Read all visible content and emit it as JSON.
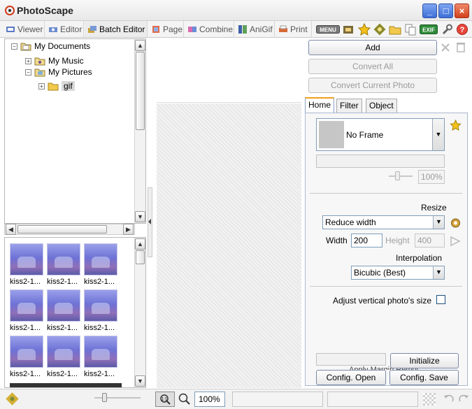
{
  "window": {
    "title": "PhotoScape",
    "colors": {
      "accent": "#3d6fd8",
      "close": "#d2401c",
      "folder": "#f2c94c"
    }
  },
  "tabs": [
    {
      "label": "Viewer",
      "icon": "viewer-icon"
    },
    {
      "label": "Editor",
      "icon": "editor-icon"
    },
    {
      "label": "Batch Editor",
      "icon": "batch-editor-icon"
    },
    {
      "label": "Page",
      "icon": "page-icon"
    },
    {
      "label": "Combine",
      "icon": "combine-icon"
    },
    {
      "label": "AniGif",
      "icon": "anigif-icon"
    },
    {
      "label": "Print",
      "icon": "print-icon"
    }
  ],
  "toolbar_icons": [
    "menu-icon",
    "film-icon",
    "star-icon",
    "gear-icon",
    "folder-icon",
    "copy-icon",
    "exif-icon",
    "wrench-icon",
    "help-icon"
  ],
  "toolbar": {
    "menu_label": "MENU",
    "exif_label": "EXIF"
  },
  "tree": {
    "root": "My Documents",
    "children": [
      "My Music",
      "My Pictures"
    ],
    "selected": "gif"
  },
  "thumbnails": {
    "items": [
      "kiss2-1...",
      "kiss2-1...",
      "kiss2-1...",
      "kiss2-1...",
      "kiss2-1...",
      "kiss2-1...",
      "kiss2-1...",
      "kiss2-1...",
      "kiss2-1..."
    ]
  },
  "actions": {
    "add": "Add",
    "convert_all": "Convert All",
    "convert_current": "Convert Current Photo"
  },
  "panel_tabs": [
    "Home",
    "Filter",
    "Object"
  ],
  "home": {
    "frame_value": "No Frame",
    "frame_percent": "100%",
    "resize_label": "Resize",
    "resize_mode": "Reduce width",
    "width_label": "Width",
    "width_value": "200",
    "height_label": "Height",
    "height_value": "400",
    "interpolation_label": "Interpolation",
    "interpolation_value": "Bicubic (Best)",
    "adjust_vertical": "Adjust vertical photo's size",
    "adjust_vertical_checked": false,
    "hidden_text": "Apply Margin Remove..."
  },
  "bottom_buttons": {
    "initialize": "Initialize",
    "config_open": "Config. Open",
    "config_save": "Config. Save"
  },
  "status": {
    "zoom": "100%"
  }
}
